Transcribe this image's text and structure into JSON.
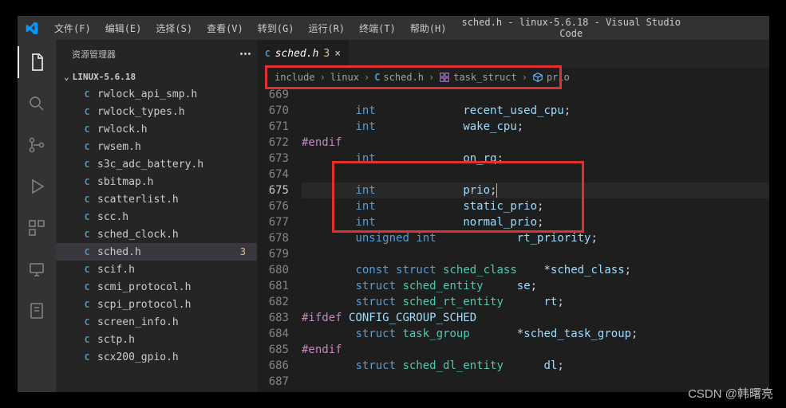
{
  "title": "sched.h - linux-5.6.18 - Visual Studio Code",
  "menus": [
    "文件(F)",
    "编辑(E)",
    "选择(S)",
    "查看(V)",
    "转到(G)",
    "运行(R)",
    "终端(T)",
    "帮助(H)"
  ],
  "sidebar": {
    "header": "资源管理器",
    "folder": "LINUX-5.6.18",
    "items": [
      {
        "icon": "C",
        "name": "rwlock_api_smp.h"
      },
      {
        "icon": "C",
        "name": "rwlock_types.h"
      },
      {
        "icon": "C",
        "name": "rwlock.h"
      },
      {
        "icon": "C",
        "name": "rwsem.h"
      },
      {
        "icon": "C",
        "name": "s3c_adc_battery.h"
      },
      {
        "icon": "C",
        "name": "sbitmap.h"
      },
      {
        "icon": "C",
        "name": "scatterlist.h"
      },
      {
        "icon": "C",
        "name": "scc.h"
      },
      {
        "icon": "C",
        "name": "sched_clock.h"
      },
      {
        "icon": "C",
        "name": "sched.h",
        "selected": true,
        "git": "3"
      },
      {
        "icon": "C",
        "name": "scif.h"
      },
      {
        "icon": "C",
        "name": "scmi_protocol.h"
      },
      {
        "icon": "C",
        "name": "scpi_protocol.h"
      },
      {
        "icon": "C",
        "name": "screen_info.h"
      },
      {
        "icon": "C",
        "name": "sctp.h"
      },
      {
        "icon": "C",
        "name": "scx200_gpio.h"
      }
    ]
  },
  "tab": {
    "icon": "C",
    "name": "sched.h",
    "dirty": "3"
  },
  "breadcrumb": [
    "include",
    "linux",
    {
      "icon": "C",
      "t": "sched.h"
    },
    {
      "sym": "struct",
      "t": "task_struct"
    },
    {
      "sym": "field",
      "t": "prio"
    }
  ],
  "lines": [
    {
      "n": 669,
      "html": "        "
    },
    {
      "n": 670,
      "html": "        <span class='kw'>int</span>             <span class='ident'>recent_used_cpu</span>;"
    },
    {
      "n": 671,
      "html": "        <span class='kw'>int</span>             <span class='ident'>wake_cpu</span>;"
    },
    {
      "n": 672,
      "html": "<span class='kw2'>#endif</span>"
    },
    {
      "n": 673,
      "html": "        <span class='kw'>int</span>             <span class='ident'>on_rq</span>;"
    },
    {
      "n": 674,
      "html": ""
    },
    {
      "n": 675,
      "cur": true,
      "html": "        <span class='kw'>int</span>             <span class='ident'>prio</span>;<span class='cursor'></span>"
    },
    {
      "n": 676,
      "html": "        <span class='kw'>int</span>             <span class='ident'>static_prio</span>;"
    },
    {
      "n": 677,
      "html": "        <span class='kw'>int</span>             <span class='ident'>normal_prio</span>;"
    },
    {
      "n": 678,
      "html": "        <span class='kw'>unsigned</span> <span class='kw'>int</span>            <span class='ident'>rt_priority</span>;"
    },
    {
      "n": 679,
      "html": ""
    },
    {
      "n": 680,
      "html": "        <span class='kw'>const</span> <span class='kw'>struct</span> <span class='type'>sched_class</span>    *<span class='ident'>sched_class</span>;"
    },
    {
      "n": 681,
      "html": "        <span class='kw'>struct</span> <span class='type'>sched_entity</span>     <span class='ident'>se</span>;"
    },
    {
      "n": 682,
      "html": "        <span class='kw'>struct</span> <span class='type'>sched_rt_entity</span>      <span class='ident'>rt</span>;"
    },
    {
      "n": 683,
      "html": "<span class='kw2'>#ifdef</span> <span class='ident'>CONFIG_CGROUP_SCHED</span>"
    },
    {
      "n": 684,
      "html": "        <span class='kw'>struct</span> <span class='type'>task_group</span>       *<span class='ident'>sched_task_group</span>;"
    },
    {
      "n": 685,
      "html": "<span class='kw2'>#endif</span>"
    },
    {
      "n": 686,
      "html": "        <span class='kw'>struct</span> <span class='type'>sched_dl_entity</span>      <span class='ident'>dl</span>;"
    },
    {
      "n": 687,
      "html": ""
    }
  ],
  "watermark": "CSDN @韩曙亮"
}
